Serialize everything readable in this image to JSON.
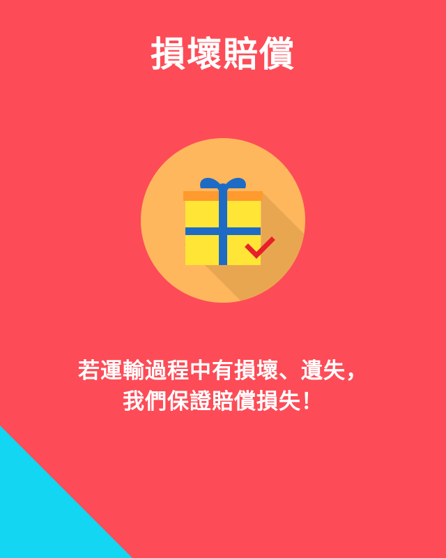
{
  "title": "損壞賠償",
  "message": {
    "line1": "若運輸過程中有損壞、遺失，",
    "line2": "我們保證賠償損失！"
  },
  "colors": {
    "background": "#FD4C57",
    "corner_accent": "#12D6F2",
    "circle": "#FFB75D",
    "gift_box": "#FFE636",
    "ribbon": "#1E6BC6",
    "lid_band": "#FF9A2E",
    "check": "#E8202A"
  },
  "icons": {
    "badge": "gift-box-icon",
    "check": "check-mark-icon"
  }
}
